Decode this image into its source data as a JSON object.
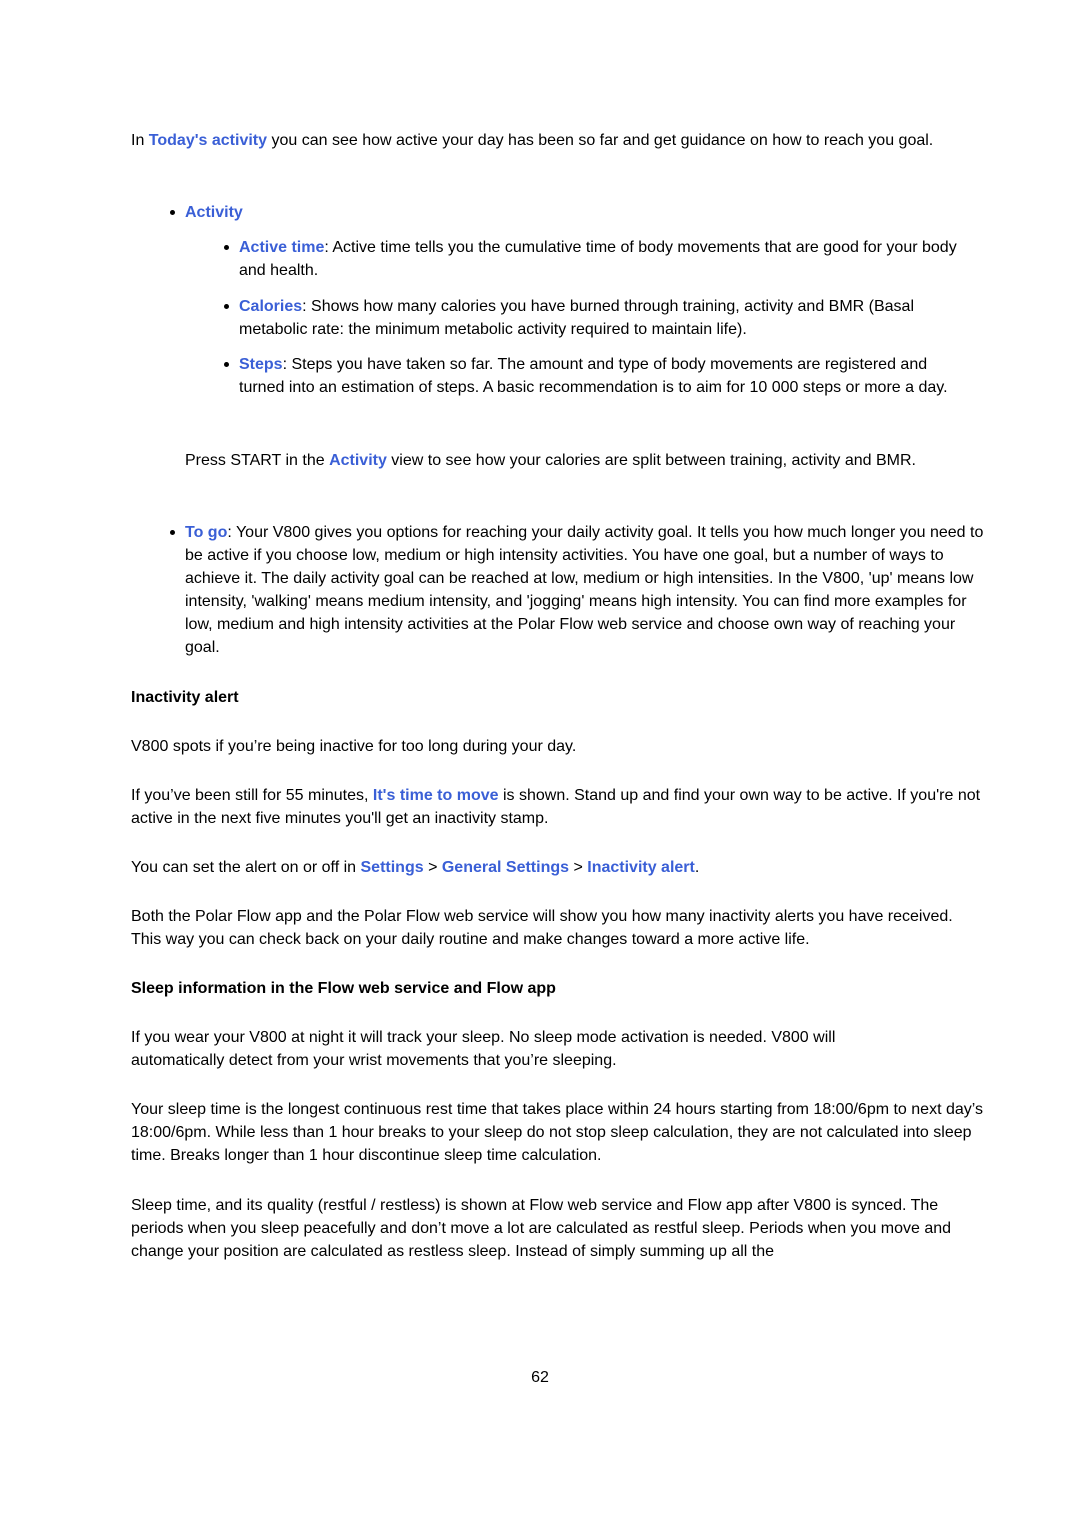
{
  "intro": {
    "pre": "In ",
    "link": "Today's activity",
    "post": " you can see how active your day has been so far and get guidance on how to reach you goal."
  },
  "activity": {
    "heading": "Activity",
    "items": [
      {
        "term": "Active time",
        "text": ": Active time tells you the cumulative time of body movements that are good for your body and health."
      },
      {
        "term": "Calories",
        "text": ": Shows how many calories you have burned through training, activity and BMR (Basal metabolic rate: the minimum metabolic activity required to maintain life)."
      },
      {
        "term": "Steps",
        "text": ": Steps you have taken so far. The amount and type of body movements are registered and turned into an estimation of steps. A basic recommendation is to aim for 10 000 steps or more a day."
      }
    ],
    "note_pre": "Press START in the ",
    "note_link": "Activity",
    "note_post": " view to see how your calories are split between training, activity and BMR."
  },
  "togo": {
    "term": "To go",
    "text": ": Your V800 gives you options for reaching your daily activity goal. It tells you how much longer you need to be active if you choose low, medium or high intensity activities. You have one goal, but a number of ways to achieve it. The daily activity goal can be reached at low, medium or high intensities. In the V800, 'up' means low intensity, 'walking' means medium intensity, and 'jogging' means high intensity. You can find more examples for low, medium and high intensity activities at the Polar Flow web service and choose own way of reaching your goal."
  },
  "inactivity": {
    "heading": "Inactivity alert",
    "p1": "V800 spots if you’re being inactive for too long during your day.",
    "p2_pre": "If you’ve been still for 55 minutes, ",
    "p2_link": "It's time to move",
    "p2_post": " is shown. Stand up and find your own way to be active. If you're not active in the next five minutes you'll get an inactivity stamp.",
    "p3_pre": "You can set the alert on or off in ",
    "p3_path": [
      "Settings",
      "General Settings",
      "Inactivity alert"
    ],
    "p3_sep": " > ",
    "p3_post": ".",
    "p4": "Both the Polar Flow app and the Polar Flow web service will show you how many inactivity alerts you have received. This way you can check back on your daily routine and make changes toward a more active life."
  },
  "sleep": {
    "heading": "Sleep information in the Flow web service and Flow app",
    "p1": "If you wear your V800 at night it will track your sleep. No sleep mode activation is needed. V800 will automatically detect from your wrist movements that you’re sleeping.",
    "p2": "Your sleep time is the longest continuous rest time that takes place within 24 hours starting from 18:00/6pm to next day’s 18:00/6pm. While less than 1 hour breaks to your sleep do not stop sleep calculation, they are not calculated into sleep time. Breaks longer than 1 hour discontinue sleep time calculation.",
    "p3": "Sleep time, and its quality (restful / restless) is shown at Flow web service and Flow app after V800 is synced. The periods when you sleep peacefully and don’t move a lot are calculated as restful sleep. Periods when you move and change your position are calculated as restless sleep. Instead of simply summing up all the"
  },
  "page_number": "62",
  "colors": {
    "link": "#3a5fd6",
    "text": "#000000"
  }
}
